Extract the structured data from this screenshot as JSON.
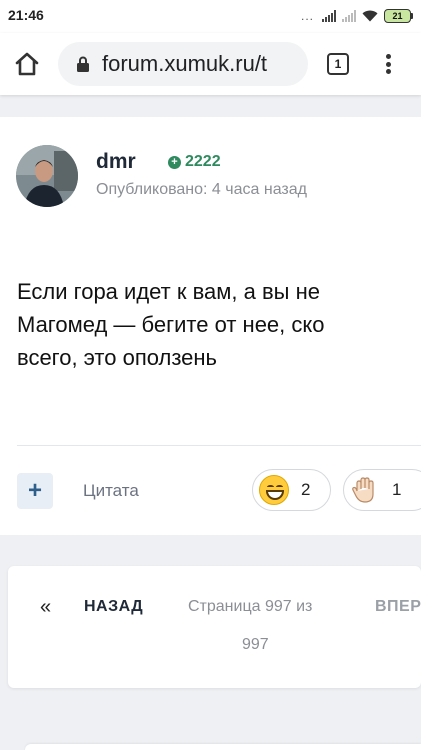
{
  "status_bar": {
    "time": "21:46",
    "dots": "...",
    "battery": "21"
  },
  "browser": {
    "url": "forum.xumuk.ru/t",
    "tab_count": "1",
    "icons": [
      "home-icon",
      "lock-icon",
      "tabs-icon",
      "more-vert-icon"
    ]
  },
  "post": {
    "author": "dmr",
    "reputation": "2222",
    "published": "Опубликовано: 4 часа назад",
    "body_lines": [
      "Если гора идет к вам, а вы не",
      "Магомед — бегите от нее, ско",
      "всего, это оползень"
    ],
    "quote_label": "Цитата",
    "reactions": [
      {
        "emoji": "grinning-face-icon",
        "count": "2"
      },
      {
        "emoji": "raised-hand-icon",
        "count": "1"
      }
    ]
  },
  "pagination": {
    "prev_arrow": "«",
    "prev_label": "НАЗАД",
    "page_info_line1": "Страница 997 из",
    "page_info_line2": "997",
    "next_label": "ВПЕР"
  },
  "colors": {
    "accent_green": "#2f8a5f",
    "page_bg": "#eef0f3",
    "muted_text": "#8b8f95"
  }
}
